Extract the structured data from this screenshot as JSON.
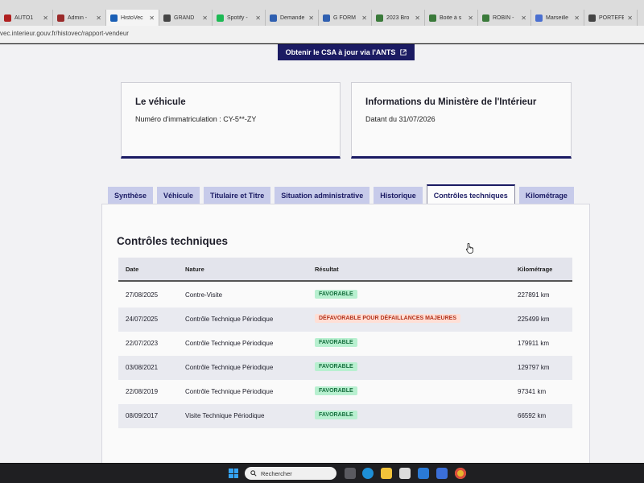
{
  "browser": {
    "tabs": [
      {
        "label": "AUTO1",
        "color": "#b02020",
        "active": false
      },
      {
        "label": "Admin -",
        "color": "#9a2a2a",
        "active": false
      },
      {
        "label": "HistoVec",
        "color": "#1b5fb5",
        "active": true
      },
      {
        "label": "GRAND",
        "color": "#444444",
        "active": false
      },
      {
        "label": "Spotify -",
        "color": "#1db954",
        "active": false
      },
      {
        "label": "Demande",
        "color": "#2f5fb0",
        "active": false
      },
      {
        "label": "G FORM",
        "color": "#2f5fb0",
        "active": false
      },
      {
        "label": "2023 Bro",
        "color": "#3a7a3a",
        "active": false
      },
      {
        "label": "Boite à s",
        "color": "#3a7a3a",
        "active": false
      },
      {
        "label": "ROBIN -",
        "color": "#3a7a3a",
        "active": false
      },
      {
        "label": "Marseille",
        "color": "#4a6fd0",
        "active": false
      },
      {
        "label": "PORTEFE",
        "color": "#444444",
        "active": false
      }
    ],
    "url": "vec.interieur.gouv.fr/histovec/rapport-vendeur"
  },
  "header": {
    "ants_button": "Obtenir le CSA à jour via l'ANTS",
    "ants_icon": "external-link-icon"
  },
  "vehicle_card": {
    "title": "Le véhicule",
    "registration": "Numéro d'immatriculation : CY-5**-ZY"
  },
  "ministry_card": {
    "title": "Informations du Ministère de l'Intérieur",
    "date": "Datant du 31/07/2026"
  },
  "tabs": [
    {
      "label": "Synthèse",
      "active": false
    },
    {
      "label": "Véhicule",
      "active": false
    },
    {
      "label": "Titulaire et Titre",
      "active": false
    },
    {
      "label": "Situation administrative",
      "active": false
    },
    {
      "label": "Historique",
      "active": false
    },
    {
      "label": "Contrôles techniques",
      "active": true
    },
    {
      "label": "Kilométrage",
      "active": false
    }
  ],
  "section": {
    "title": "Contrôles techniques",
    "columns": [
      "Date",
      "Nature",
      "Résultat",
      "Kilométrage"
    ],
    "rows": [
      {
        "date": "27/08/2025",
        "nature": "Contre-Visite",
        "result": "FAVORABLE",
        "status": "ok",
        "km": "227891 km"
      },
      {
        "date": "24/07/2025",
        "nature": "Contrôle Technique Périodique",
        "result": "DÉFAVORABLE POUR DÉFAILLANCES MAJEURES",
        "status": "ko",
        "km": "225499 km"
      },
      {
        "date": "22/07/2023",
        "nature": "Contrôle Technique Périodique",
        "result": "FAVORABLE",
        "status": "ok",
        "km": "179911 km"
      },
      {
        "date": "03/08/2021",
        "nature": "Contrôle Technique Périodique",
        "result": "FAVORABLE",
        "status": "ok",
        "km": "129797 km"
      },
      {
        "date": "22/08/2019",
        "nature": "Contrôle Technique Périodique",
        "result": "FAVORABLE",
        "status": "ok",
        "km": "97341 km"
      },
      {
        "date": "08/09/2017",
        "nature": "Visite Technique Périodique",
        "result": "FAVORABLE",
        "status": "ok",
        "km": "66592 km"
      }
    ]
  },
  "taskbar": {
    "search_placeholder": "Rechercher",
    "icons": [
      "windows-start-icon",
      "search-icon",
      "task-view-icon",
      "edge-icon",
      "file-explorer-icon",
      "calendar-icon",
      "mail-icon",
      "store-icon",
      "chrome-icon"
    ]
  },
  "colors": {
    "primary": "#1b1b63",
    "tab_inactive": "#c7cbea",
    "favorable_bg": "#b8f0d0",
    "favorable_fg": "#17703f",
    "unfavorable_bg": "#ffdfd6",
    "unfavorable_fg": "#b3331c"
  }
}
